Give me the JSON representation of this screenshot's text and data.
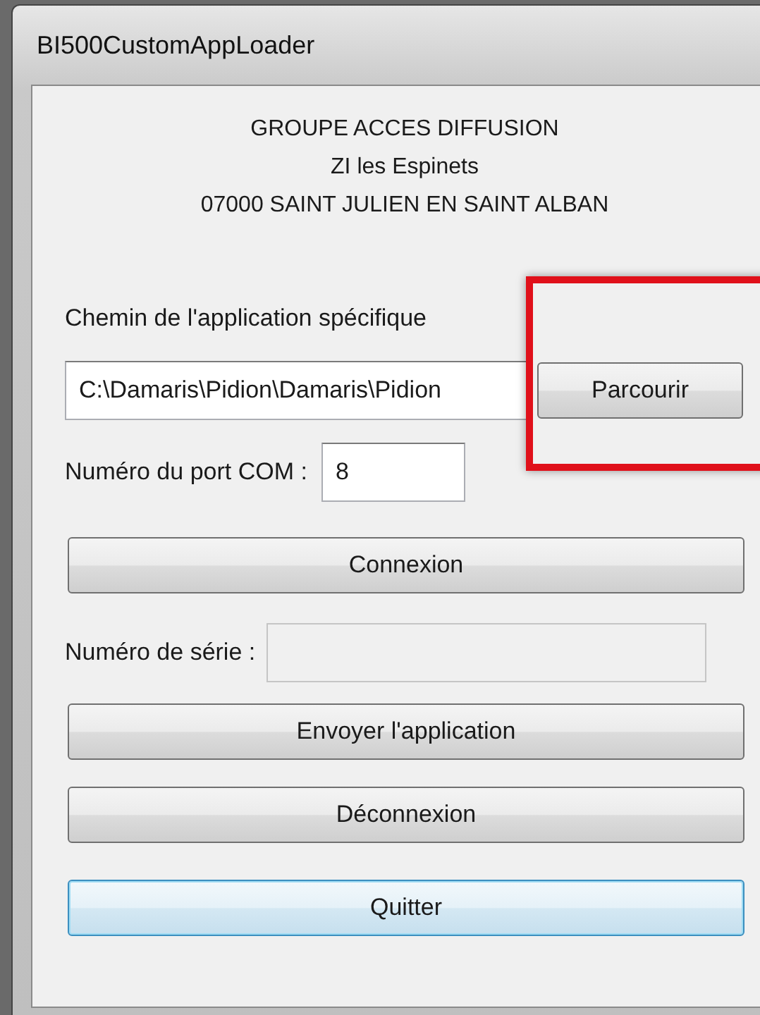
{
  "window": {
    "title": "BI500CustomAppLoader"
  },
  "header": [
    "GROUPE ACCES DIFFUSION",
    "ZI les Espinets",
    "07000 SAINT JULIEN EN SAINT ALBAN"
  ],
  "path": {
    "label": "Chemin de l'application spécifique",
    "value": "C:\\Damaris\\Pidion\\Damaris\\Pidion",
    "browse": "Parcourir",
    "highlighted": true
  },
  "com_port": {
    "label": "Numéro du port COM :",
    "value": "8"
  },
  "connect": {
    "label": "Connexion",
    "focused": false
  },
  "serial": {
    "label": "Numéro de série :",
    "disabled": true
  },
  "buttons": [
    {
      "label": "Envoyer l'application",
      "focused": false
    },
    {
      "label": "Déconnexion",
      "focused": false
    },
    {
      "label": "Quitter",
      "focused": true
    }
  ]
}
